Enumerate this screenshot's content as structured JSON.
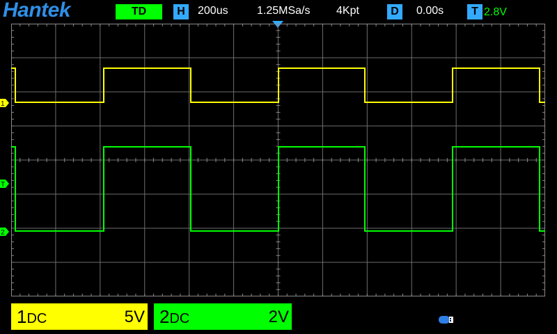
{
  "header": {
    "brand": "Hantek",
    "mode": "TD",
    "h_icon": "H",
    "timebase": "200us",
    "sample_rate": "1.25MSa/s",
    "memory_depth": "4Kpt",
    "d_icon": "D",
    "delay": "0.00s",
    "t_icon": "T",
    "trigger_level": "2.8V"
  },
  "markers": {
    "ch1": "1",
    "trigger": "T",
    "ch2": "2"
  },
  "channels": [
    {
      "number": "1",
      "coupling": "DC",
      "scale": "5V",
      "color": "#ffff00"
    },
    {
      "number": "2",
      "coupling": "DC",
      "scale": "2V",
      "color": "#00ff00"
    }
  ],
  "colors": {
    "accent": "#2f8fe6",
    "ch1": "#ffff00",
    "ch2": "#00ff00",
    "icon_box": "#33aaff"
  },
  "icons": {
    "trigger_position": "down-triangle-icon",
    "usb": "usb-drive-icon"
  }
}
